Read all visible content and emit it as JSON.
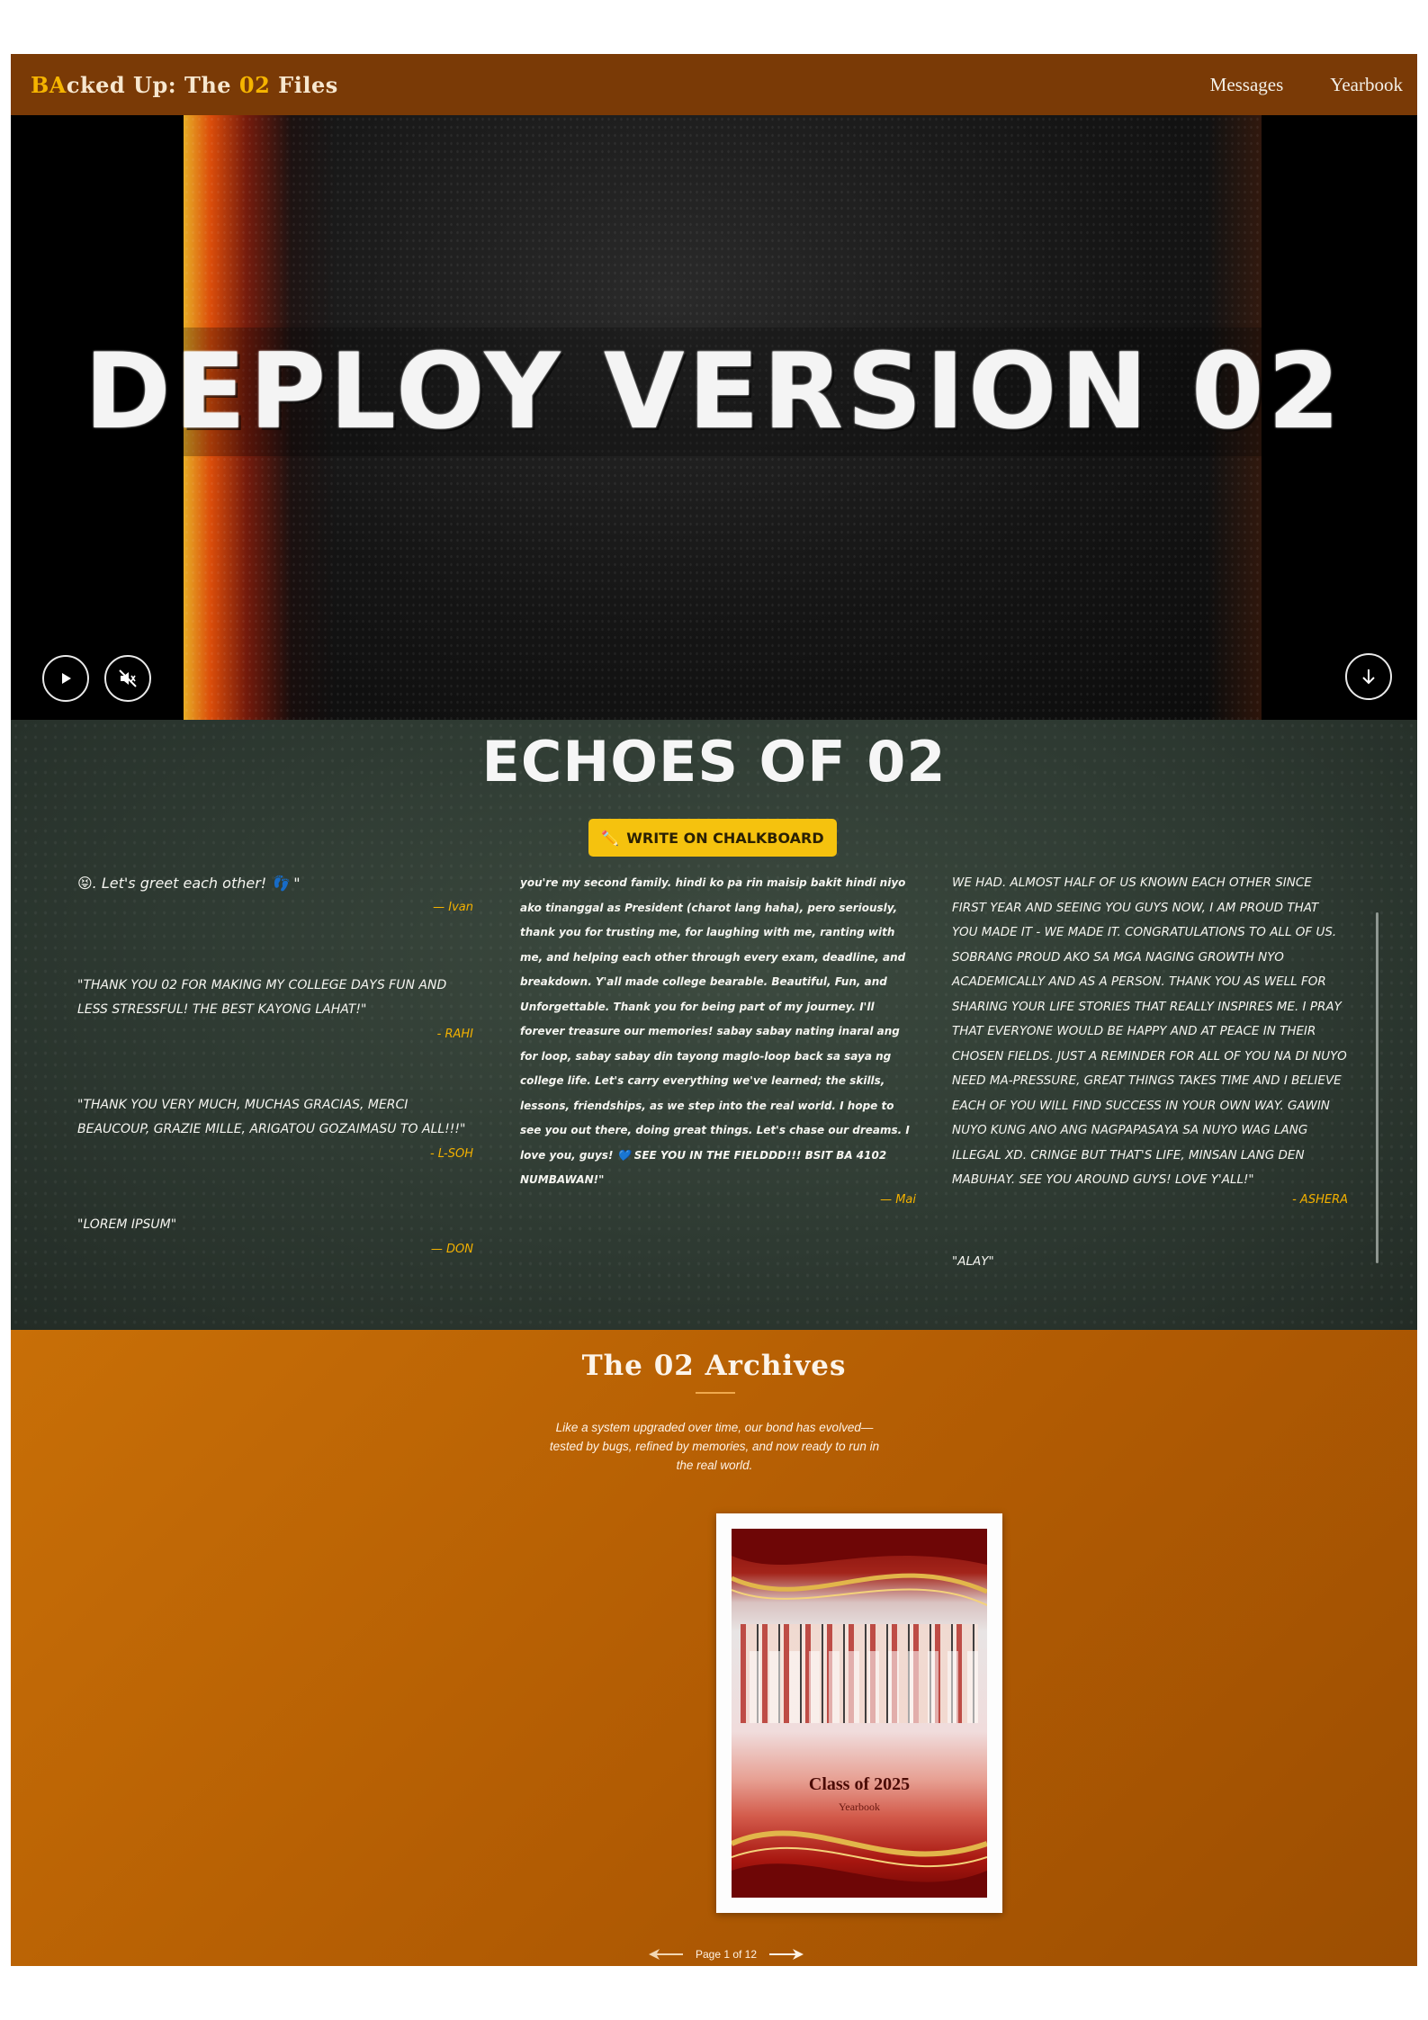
{
  "header": {
    "brand_part1": "BA",
    "brand_part2": "cked Up: The ",
    "brand_part3": "02",
    "brand_part4": " Files",
    "nav": [
      "Messages",
      "Yearbook"
    ]
  },
  "hero": {
    "title": "DEPLOY VERSION 02",
    "icons": {
      "play": "play-icon",
      "mute": "muted-speaker-icon",
      "scroll_down": "arrow-down-icon"
    }
  },
  "chalkboard": {
    "title": "ECHOES OF 02",
    "write_button": "WRITE ON CHALKBOARD",
    "write_icon": "pencil-icon",
    "column1": [
      {
        "text": "😝. Let's greet each other! 👣 \"",
        "author": "— Ivan"
      },
      {
        "text": "\"Thank you 02 for making my college days fun and less stressful! the best kayong lahat!\"",
        "author": "- RAHI"
      },
      {
        "text": "\"Thank you very much, muchas gracias, merci beaucoup, grazie mille, arigatou gozaimasu to all!!!\"",
        "author": "- L-SOH"
      },
      {
        "text": "\"Lorem ipsum\"",
        "author": "— DON"
      }
    ],
    "column2": [
      {
        "text": "you're my second family. hindi ko pa rin maisip bakit hindi niyo ako tinanggal as President (charot lang haha), pero seriously, thank you for trusting me, for laughing with me, ranting with me, and helping each other through every exam, deadline, and breakdown. Y'all made college bearable. Beautiful, Fun, and Unforgettable. Thank you for being part of my journey. I'll forever treasure our memories! sabay sabay nating inaral ang for loop, sabay sabay din tayong maglo-loop back sa saya ng college life. Let's carry everything we've learned; the skills, lessons, friendships, as we step into the real world. I hope to see you out there, doing great things. Let's chase our dreams. I love you, guys! 💙 SEE YOU IN THE FIELDDD!!! BSIT BA 4102 NUMBAWAN!\"",
        "author": "— Mai"
      }
    ],
    "column3": [
      {
        "text": "We had. Almost half of us known each other since first year and seeing you guys now, I am proud that you made it - we made it. Congratulations to all of us. Sobrang proud ako sa mga naging growth nyo academically and as a person. Thank you as well for sharing your life stories that really inspires me. I pray that everyone would be happy and at peace in their chosen fields. Just a reminder for all of you na di nuyo need ma-pressure, great things takes time and I believe each of you will find success in your own way. Gawin nuyo kung ano ang nagpapasaya sa nuyo wag lang illegal xD. Cringe but that's life, minsan lang den mabuhay. See you around guys! Love y'all!\"",
        "author": "- ASHERA"
      },
      {
        "text": "\"Alay\"",
        "author": ""
      }
    ]
  },
  "archives": {
    "title": "The 02 Archives",
    "description": "Like a system upgraded over time, our bond has evolved—tested by bugs, refined by memories, and now ready to run in the real world.",
    "book_title": "Class of 2025",
    "book_subtitle": "Yearbook",
    "pager": "Page 1 of 12",
    "icons": {
      "prev": "arrow-left-icon",
      "next": "arrow-right-icon"
    }
  },
  "colors": {
    "header_bg": "#7a3a06",
    "brand_accent": "#f5b400",
    "chalkboard_bg": "#2e3a32",
    "button_yellow": "#f5c20e",
    "signature_orange": "#f3b100",
    "archives_bg": "#b15b03"
  }
}
